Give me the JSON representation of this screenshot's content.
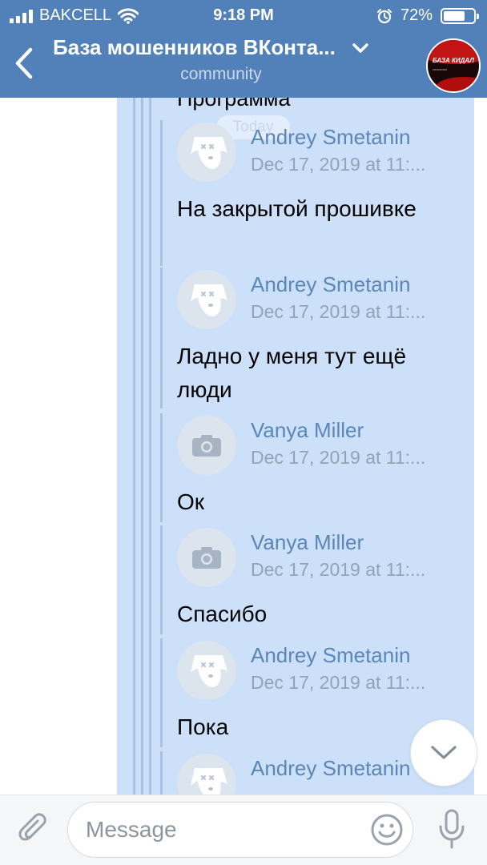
{
  "status_bar": {
    "carrier": "BAKCELL",
    "time": "9:18 PM",
    "battery": "72%",
    "battery_level": 0.72
  },
  "header": {
    "title": "База мошенников ВКонта...",
    "subtitle": "community",
    "avatar_logo": "БАЗА КИДАЛ",
    "background_color": "#5181b8"
  },
  "conversation": {
    "date_chip": "Today",
    "top_partial_text": "Программа",
    "messages": [
      {
        "author": "Andrey Smetanin",
        "date": "Dec 17, 2019 at 11:...",
        "text": "На закрытой прошивке",
        "avatar_icon": "deactivated-dog-icon"
      },
      {
        "author": "Andrey Smetanin",
        "date": "Dec 17, 2019 at 11:...",
        "text": "Ладно у меня тут ещё люди",
        "avatar_icon": "deactivated-dog-icon"
      },
      {
        "author": "Vanya Miller",
        "date": "Dec 17, 2019 at 11:...",
        "text": "Ок",
        "avatar_icon": "camera-icon"
      },
      {
        "author": "Vanya Miller",
        "date": "Dec 17, 2019 at 11:...",
        "text": "Спасибо",
        "avatar_icon": "camera-icon"
      },
      {
        "author": "Andrey Smetanin",
        "date": "Dec 17, 2019 at 11:...",
        "text": "Пока",
        "avatar_icon": "deactivated-dog-icon"
      },
      {
        "author": "Andrey Smetanin",
        "date": "",
        "text": "",
        "avatar_icon": "deactivated-dog-icon"
      }
    ],
    "selection_color": "#cce0fa",
    "author_color": "#5a86b8"
  },
  "composer": {
    "placeholder": "Message"
  }
}
